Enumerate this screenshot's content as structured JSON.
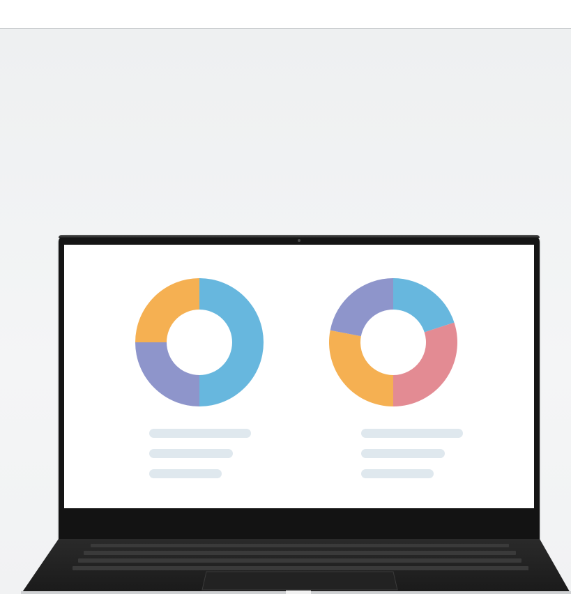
{
  "colors": {
    "blue": "#67b7de",
    "orange": "#f5b052",
    "purple": "#8e95cb",
    "pink": "#e38b93",
    "placeholder": "#dfe8ee",
    "bezel": "#151515",
    "background": "#f0f2f3"
  },
  "chart_data": [
    {
      "type": "pie",
      "donut": true,
      "values": [
        50,
        25,
        25
      ],
      "colors": [
        "#67b7de",
        "#8e95cb",
        "#f5b052"
      ],
      "start": "top",
      "direction": "clockwise"
    },
    {
      "type": "pie",
      "donut": true,
      "values": [
        20,
        30,
        28,
        22
      ],
      "colors": [
        "#67b7de",
        "#e38b93",
        "#f5b052",
        "#8e95cb"
      ],
      "start": "top",
      "direction": "clockwise"
    }
  ]
}
